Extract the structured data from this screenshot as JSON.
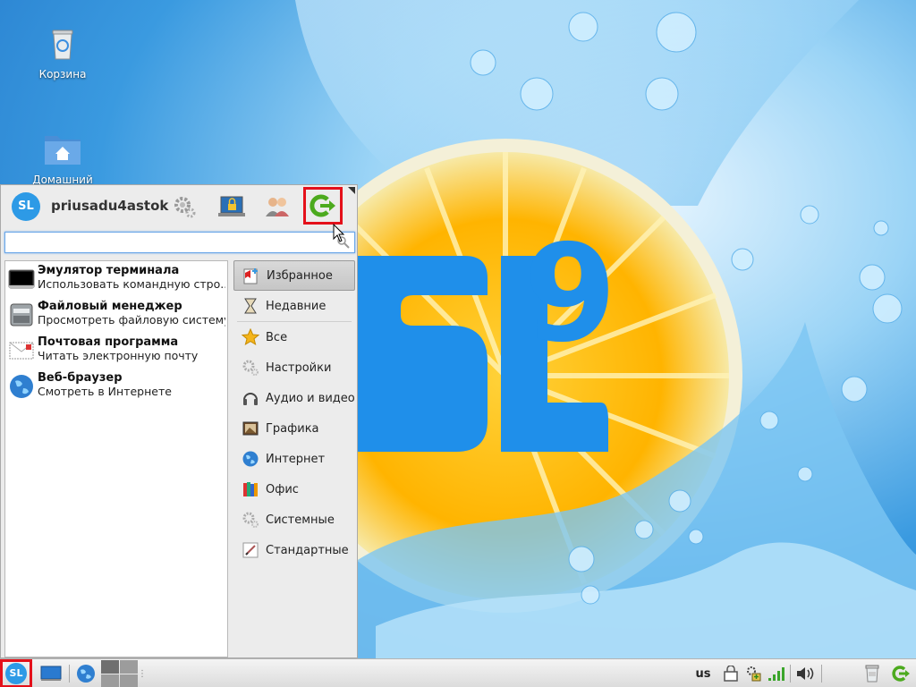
{
  "desktop": {
    "icons": [
      {
        "label": "Корзина",
        "icon": "trash-icon"
      },
      {
        "label": "Домашний",
        "icon": "home-folder-icon"
      }
    ],
    "wallpaper_logo": "SL",
    "wallpaper_logo_sup": "9"
  },
  "menu": {
    "avatar_text": "SL",
    "username": "priusadu4astok",
    "header_buttons": [
      "settings-icon",
      "lock-screen-icon",
      "switch-user-icon",
      "logout-icon"
    ],
    "search": {
      "value": "",
      "placeholder": ""
    },
    "favorites": [
      {
        "name": "Эмулятор терминала",
        "desc": "Использовать командную стро...",
        "icon": "terminal-icon"
      },
      {
        "name": "Файловый менеджер",
        "desc": "Просмотреть файловую систему",
        "icon": "file-manager-icon"
      },
      {
        "name": "Почтовая программа",
        "desc": "Читать электронную почту",
        "icon": "mail-icon"
      },
      {
        "name": "Веб-браузер",
        "desc": "Смотреть в Интернете",
        "icon": "web-browser-icon"
      }
    ],
    "categories": [
      {
        "label": "Избранное",
        "icon": "favorites-icon",
        "selected": true
      },
      {
        "label": "Недавние",
        "icon": "recent-icon"
      },
      {
        "label": "Все",
        "icon": "all-star-icon"
      },
      {
        "label": "Настройки",
        "icon": "settings-gear-icon"
      },
      {
        "label": "Аудио и видео",
        "icon": "audio-video-icon"
      },
      {
        "label": "Графика",
        "icon": "graphics-icon"
      },
      {
        "label": "Интернет",
        "icon": "internet-globe-icon"
      },
      {
        "label": "Офис",
        "icon": "office-books-icon"
      },
      {
        "label": "Системные",
        "icon": "system-gear-icon"
      },
      {
        "label": "Стандартные",
        "icon": "accessories-icon"
      }
    ]
  },
  "taskbar": {
    "start_label": "SL",
    "keyboard_layout": "us",
    "colors": {
      "highlight": "#e4101a",
      "accent": "#2d9ae6"
    }
  }
}
